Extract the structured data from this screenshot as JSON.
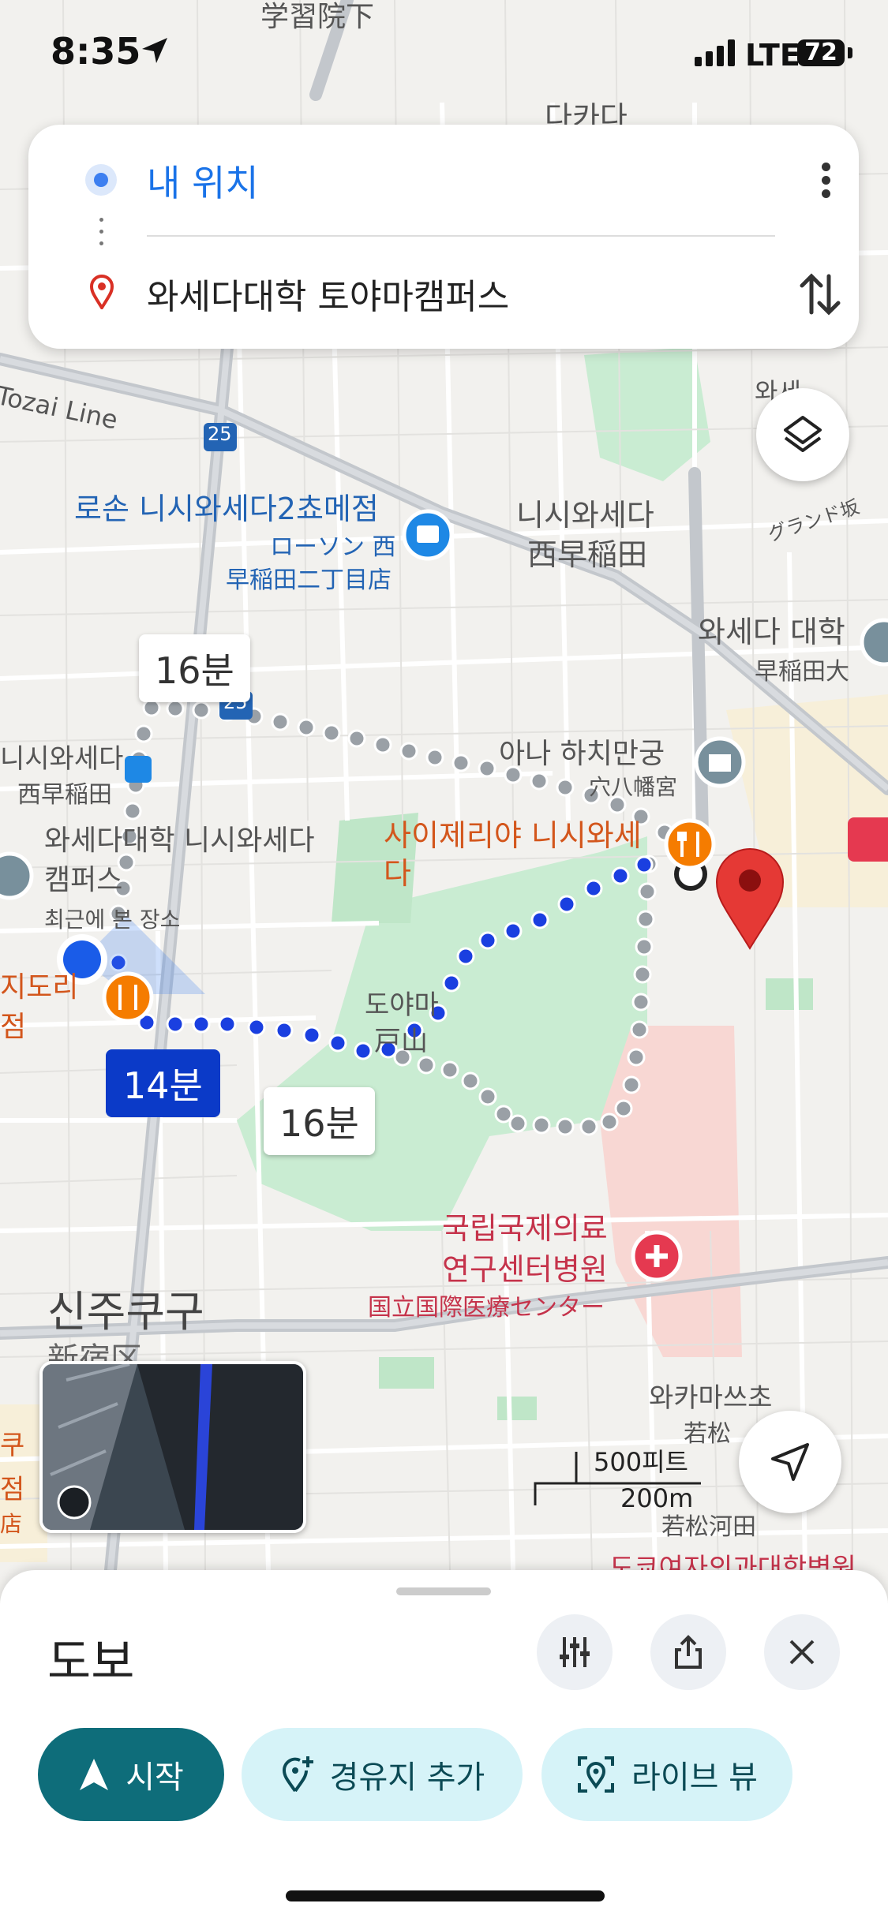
{
  "status_bar": {
    "time": "8:35",
    "network": "LTE",
    "battery": "72"
  },
  "directions": {
    "origin": "내 위치",
    "destination": "와세다대학 토야마캠퍼스"
  },
  "route_labels": {
    "selected": "14분",
    "alt_1": "16분",
    "alt_2": "16분"
  },
  "map_labels": {
    "top_1": "学習院下",
    "top_2": "다카다",
    "tozai": "Tozai Line",
    "route_badge_1": "25",
    "route_badge_2": "25",
    "lawson_kr": "로손 니시와세다2쵸메점",
    "lawson_jp_1": "ローソン 西",
    "lawson_jp_2": "早稲田二丁目店",
    "nishiwaseda_kr": "니시와세다",
    "nishiwaseda_jp": "西早稲田",
    "grand_saka": "グランド坂",
    "waseda_kr": "와세다 대학",
    "waseda_jp": "早稲田大",
    "waseda_top": "와세",
    "station_kr": "니시와세다",
    "station_jp": "西早稲田",
    "campus_1": "와세다대학 니시와세다",
    "campus_2": "캠퍼스",
    "recent": "최근에 본 장소",
    "ana_kr": "아나 하치만궁",
    "ana_jp": "穴八幡宮",
    "saizeriya_1": "사이제리야 니시와세",
    "saizeriya_2": "다",
    "jidori_1": "지도리",
    "jidori_2": "점",
    "toyama_kr": "도야마",
    "toyama_jp": "戸山",
    "hospital_1": "국립국제의료",
    "hospital_2": "연구센터병원",
    "hospital_jp": "国立国際医療センター",
    "shinjuku_kr": "신주쿠구",
    "shinjuku_jp": "新宿区",
    "wakamatsu_kr": "와카마쓰초",
    "wakamatsu_jp": "若松",
    "wakamatsu_kawada": "若松河田",
    "scale_ft": "500피트",
    "scale_m": "200m",
    "left_1": "쿠",
    "left_2": "점",
    "left_3": "店",
    "bottom_right": "도쿄여자의과대학병원"
  },
  "bottom_sheet": {
    "mode": "도보",
    "start": "시작",
    "add_stop": "경유지 추가",
    "live_view": "라이브 뷰"
  },
  "colors": {
    "selected_route": "#1a3fe0",
    "alt_route": "#9aa0a6",
    "accent_teal": "#0e6d7a",
    "pill_bg": "#d6f3f8",
    "pin_red": "#e53935"
  }
}
